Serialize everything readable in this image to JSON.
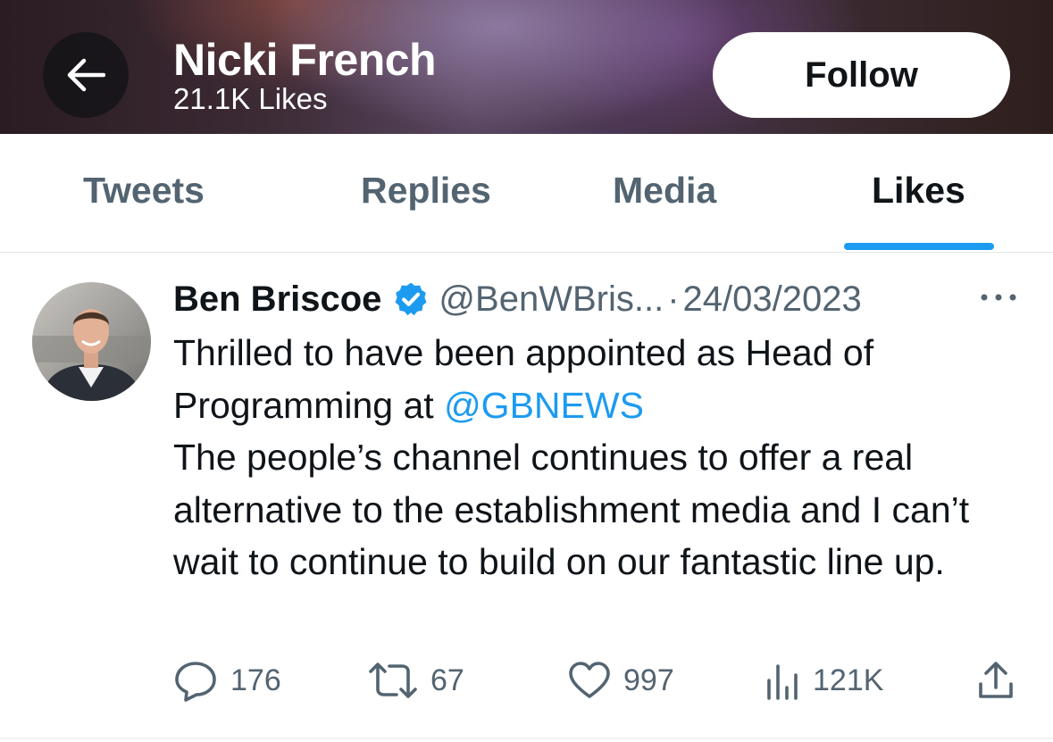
{
  "header": {
    "title": "Nicki French",
    "subtitle": "21.1K Likes",
    "follow_label": "Follow"
  },
  "tabs": [
    {
      "label": "Tweets",
      "active": false
    },
    {
      "label": "Replies",
      "active": false
    },
    {
      "label": "Media",
      "active": false
    },
    {
      "label": "Likes",
      "active": true
    }
  ],
  "tweet": {
    "author_name": "Ben Briscoe",
    "verified": true,
    "handle": "@BenWBris...",
    "separator": "·",
    "date": "24/03/2023",
    "text_part1": "Thrilled to have been appointed as Head of Programming at ",
    "mention": "@GBNEWS",
    "text_part2": "The people’s channel continues to offer a real alternative to the establishment media and I can’t wait to continue to build on our fantastic line up.",
    "actions": {
      "replies": "176",
      "retweets": "67",
      "likes": "997",
      "views": "121K"
    }
  },
  "colors": {
    "accent": "#1d9bf0",
    "secondary_text": "#536471",
    "primary_text": "#0f1419"
  },
  "icons": {
    "back": "arrow-left-icon",
    "verified": "verified-badge-icon",
    "more": "more-horizontal-icon",
    "reply": "reply-icon",
    "retweet": "retweet-icon",
    "like": "heart-icon",
    "views": "views-bar-chart-icon",
    "share": "share-icon"
  }
}
